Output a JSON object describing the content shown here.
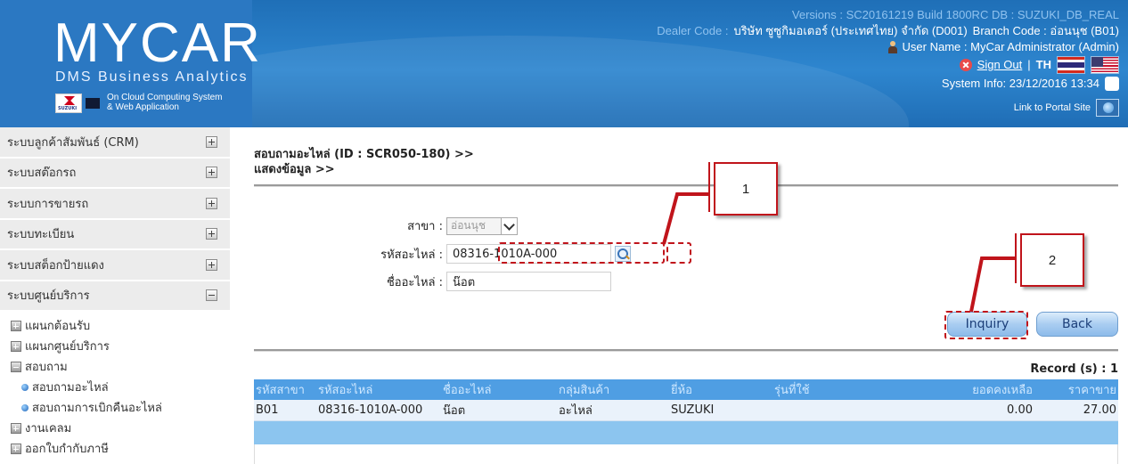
{
  "header": {
    "logo_main": "MYCAR",
    "logo_sub": "DMS Business Analytics",
    "cloud_line1": "On Cloud Computing System",
    "cloud_line2": "& Web Application",
    "versions": "Versions : SC20161219 Build 1800RC DB : SUZUKI_DB_REAL",
    "dealer_prefix": "Dealer Code :",
    "dealer_value": "บริษัท ซูซูกิมอเตอร์ (ประเทศไทย) จำกัด (D001)",
    "branch": "Branch Code : อ่อนนุช (B01)",
    "user_name": "User Name : MyCar Administrator  (Admin)",
    "sign_out": "Sign Out",
    "lang_sep": "|",
    "lang": "TH",
    "system_info": "System Info: 23/12/2016 13:34",
    "portal_link": "Link to Portal Site"
  },
  "sidebar": {
    "menus": [
      {
        "label": "ระบบลูกค้าสัมพันธ์ (CRM)",
        "icon": "plus-icon"
      },
      {
        "label": "ระบบสต๊อกรถ",
        "icon": "plus-icon"
      },
      {
        "label": "ระบบการขายรถ",
        "icon": "plus-icon"
      },
      {
        "label": "ระบบทะเบียน",
        "icon": "plus-icon"
      },
      {
        "label": "ระบบสต็อกป้ายแดง",
        "icon": "plus-icon"
      },
      {
        "label": "ระบบศูนย์บริการ",
        "icon": "minus-icon"
      }
    ],
    "sub": [
      {
        "label": "แผนกต้อนรับ"
      },
      {
        "label": "แผนกศูนย์บริการ"
      },
      {
        "label": "สอบถาม"
      },
      {
        "label": "สอบถามอะไหล่"
      },
      {
        "label": "สอบถามการเบิกคืนอะไหล่"
      },
      {
        "label": "งานเคลม"
      },
      {
        "label": "ออกใบกำกับภาษี"
      }
    ]
  },
  "main": {
    "breadcrumb_line1": "สอบถามอะไหล่ (ID : SCR050-180) >>",
    "breadcrumb_line2": "แสดงข้อมูล >>",
    "branch_label": "สาขา :",
    "branch_value": "อ่อนนุช",
    "part_code_label": "รหัสอะไหล่ :",
    "part_code_value": "08316-1010A-000",
    "part_name_label": "ชื่ออะไหล่ :",
    "part_name_value": "น๊อต",
    "inquiry_button": "Inquiry",
    "back_button": "Back",
    "record_count": "Record (s) : 1"
  },
  "table": {
    "headers": [
      "รหัสสาขา",
      "รหัสอะไหล่",
      "ชื่ออะไหล่",
      "กลุ่มสินค้า",
      "ยี่ห้อ",
      "รุ่นที่ใช้",
      "ยอดคงเหลือ",
      "ราคาขาย"
    ],
    "rows": [
      [
        "B01",
        "08316-1010A-000",
        "น๊อต",
        "อะไหล่",
        "SUZUKI",
        "",
        "0.00",
        "27.00"
      ]
    ]
  },
  "annotations": {
    "callout1": "1",
    "callout2": "2",
    "accent_color": "#c0141b"
  }
}
